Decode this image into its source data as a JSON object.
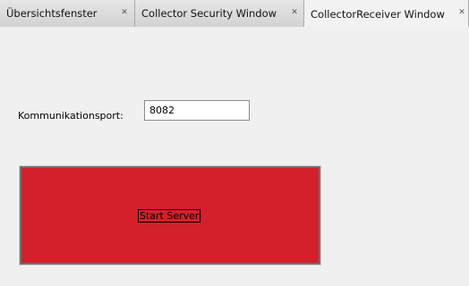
{
  "tabs": [
    {
      "label": "Übersichtsfenster",
      "close_icon": "close-icon"
    },
    {
      "label": "Collector Security Window",
      "close_icon": "close-icon"
    },
    {
      "label": "CollectorReceiver Window",
      "close_icon": "close-icon",
      "active": true
    }
  ],
  "close_glyph": "✕",
  "form": {
    "port_label": "Kommunikationsport:",
    "port_value": "8082"
  },
  "start_button": {
    "label": "Start Server",
    "color": "#d4202a"
  }
}
